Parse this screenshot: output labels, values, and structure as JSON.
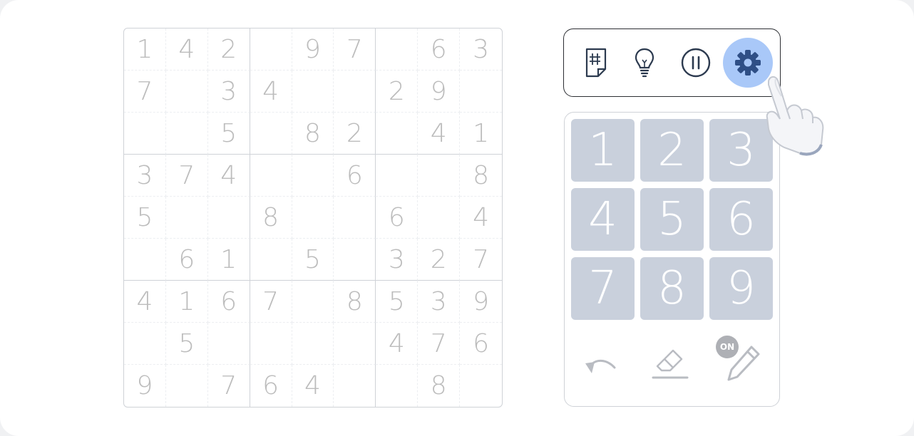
{
  "board": {
    "rows": [
      [
        "1",
        "4",
        "2",
        "",
        "9",
        "7",
        "",
        "6",
        "3"
      ],
      [
        "7",
        "",
        "3",
        "4",
        "",
        "",
        "2",
        "9",
        ""
      ],
      [
        "",
        "",
        "5",
        "",
        "8",
        "2",
        "",
        "4",
        "1"
      ],
      [
        "3",
        "7",
        "4",
        "",
        "",
        "6",
        "",
        "",
        "8"
      ],
      [
        "5",
        "",
        "",
        "8",
        "",
        "",
        "6",
        "",
        "4"
      ],
      [
        "",
        "6",
        "1",
        "",
        "5",
        "",
        "3",
        "2",
        "7"
      ],
      [
        "4",
        "1",
        "6",
        "7",
        "",
        "8",
        "5",
        "3",
        "9"
      ],
      [
        "",
        "5",
        "",
        "",
        "",
        "",
        "4",
        "7",
        "6"
      ],
      [
        "9",
        "",
        "7",
        "6",
        "4",
        "",
        "",
        "8",
        ""
      ]
    ]
  },
  "toolbar": {
    "tools": [
      {
        "icon": "notes-grid-icon"
      },
      {
        "icon": "lightbulb-icon"
      },
      {
        "icon": "pause-icon"
      },
      {
        "icon": "gear-icon",
        "active": true
      }
    ],
    "active_color": "#a9c8f8"
  },
  "keypad": {
    "keys": [
      "1",
      "2",
      "3",
      "4",
      "5",
      "6",
      "7",
      "8",
      "9"
    ],
    "key_color": "#c9d0dc"
  },
  "actions": {
    "undo_icon": "undo-icon",
    "erase_icon": "eraser-icon",
    "pencil_icon": "pencil-icon",
    "pencil_badge": "ON"
  }
}
